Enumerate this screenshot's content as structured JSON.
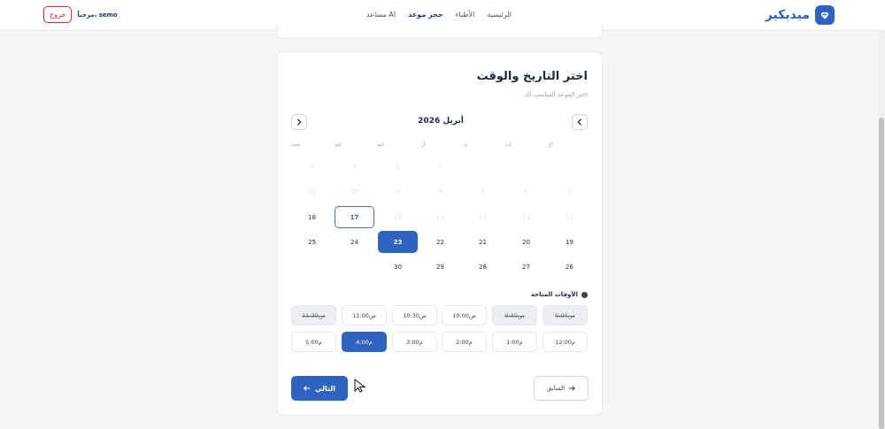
{
  "header": {
    "logo_text": "ميديكير",
    "nav": [
      "الرئيسية",
      "الأطباء",
      "حجز موعد",
      "مساعد AI"
    ],
    "active_nav": "حجز موعد",
    "greeting": "مرحباً، semo",
    "logout_label": "خروج"
  },
  "booking": {
    "title": "اختر التاريخ والوقت",
    "subtitle": "اختر الموعد المناسب لك",
    "month_label": "أبريل 2026",
    "weekdays": [
      "أح",
      "إث",
      "ث",
      "أر",
      "خم",
      "جم",
      "سب"
    ],
    "rows": [
      [
        "",
        "",
        "",
        "1",
        "2",
        "3",
        "4"
      ],
      [
        "5",
        "6",
        "7",
        "8",
        "9",
        "10",
        "11"
      ],
      [
        "12",
        "13",
        "14",
        "15",
        "16",
        "17",
        "18"
      ],
      [
        "19",
        "20",
        "21",
        "22",
        "23",
        "24",
        "25"
      ],
      [
        "26",
        "27",
        "28",
        "29",
        "30",
        "",
        ""
      ]
    ],
    "today": "17",
    "selected_day": "23",
    "times_title": "الأوقات المتاحة",
    "time_slots_row1": [
      "9:00ص",
      "9:30ص",
      "10:00ص",
      "10:30ص",
      "11:00ص",
      "11:30ص"
    ],
    "time_slots_row2": [
      "12:00م",
      "1:00م",
      "2:00م",
      "3:00م",
      "4:00م",
      "5:00م"
    ],
    "booked_slots": [
      "9:00ص",
      "9:30ص",
      "11:30ص"
    ],
    "selected_slot": "4:00م",
    "prev_label": "السابق",
    "next_label": "التالي"
  },
  "colors": {
    "primary": "#2f63c1",
    "danger": "#dc2626",
    "background": "#f5f6f8"
  }
}
